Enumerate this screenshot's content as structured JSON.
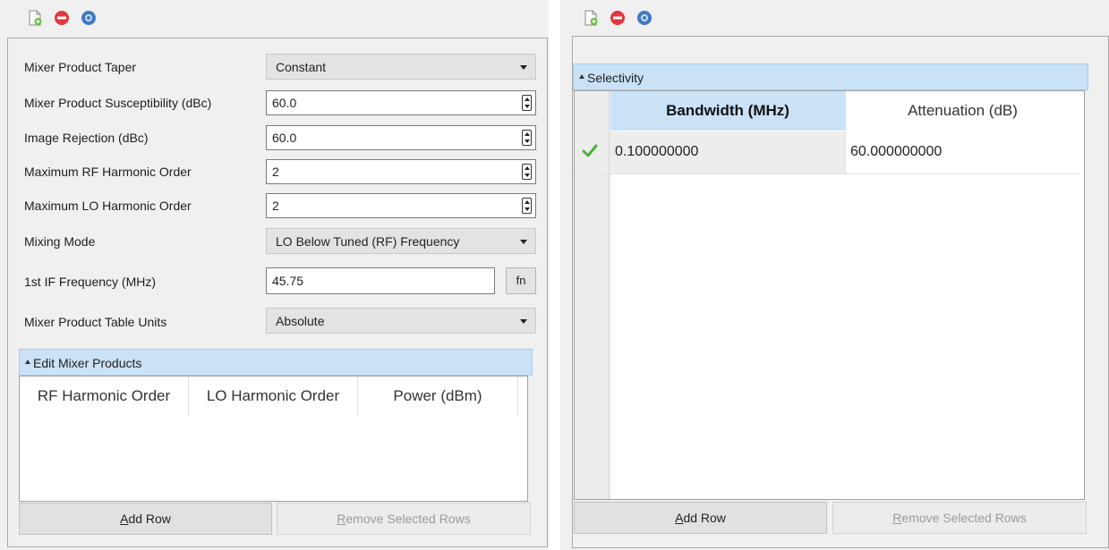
{
  "left_panel": {
    "toolbar": {
      "add_icon": "new-document-icon",
      "delete_icon": "delete-icon",
      "help_icon": "help-icon"
    },
    "fields": [
      {
        "label": "Mixer Product Taper",
        "value": "Constant",
        "kind": "dropdown"
      },
      {
        "label": "Mixer Product Susceptibility (dBc)",
        "value": "60.0",
        "kind": "spinner"
      },
      {
        "label": "Image Rejection (dBc)",
        "value": "60.0",
        "kind": "spinner"
      },
      {
        "label": "Maximum RF Harmonic Order",
        "value": "2",
        "kind": "spinner"
      },
      {
        "label": "Maximum LO Harmonic Order",
        "value": "2",
        "kind": "spinner"
      },
      {
        "label": "Mixing Mode",
        "value": "LO Below Tuned (RF) Frequency",
        "kind": "dropdown"
      },
      {
        "label": "1st IF Frequency (MHz)",
        "value": "45.75",
        "kind": "text"
      },
      {
        "label": "Mixer Product Table Units",
        "value": "Absolute",
        "kind": "dropdown"
      }
    ],
    "fn_button": "fn",
    "section_title": "Edit Mixer Products",
    "table": {
      "columns": [
        "RF Harmonic Order",
        "LO Harmonic Order",
        "Power (dBm)"
      ],
      "rows": []
    },
    "add_row_prefix": "",
    "add_row_mnemonic": "A",
    "add_row_rest": "dd Row",
    "remove_prefix": "",
    "remove_mnemonic": "R",
    "remove_rest": "emove Selected Rows"
  },
  "right_panel": {
    "toolbar": {
      "add_icon": "new-document-icon",
      "delete_icon": "delete-icon",
      "help_icon": "help-icon"
    },
    "section_title": "Selectivity",
    "table": {
      "columns": [
        "Bandwidth (MHz)",
        "Attenuation (dB)"
      ],
      "rows": [
        {
          "status_icon": "checkmark-icon",
          "bandwidth": "0.100000000",
          "attenuation": "60.000000000"
        }
      ]
    },
    "add_row_mnemonic": "A",
    "add_row_rest": "dd Row",
    "remove_mnemonic": "R",
    "remove_rest": "emove Selected Rows"
  },
  "colors": {
    "section_bar": "#c9e2f5",
    "selected_header": "#c9e2f5",
    "check_green": "#4caf3a",
    "delete_red": "#e0383e",
    "help_blue": "#3f78c8"
  }
}
